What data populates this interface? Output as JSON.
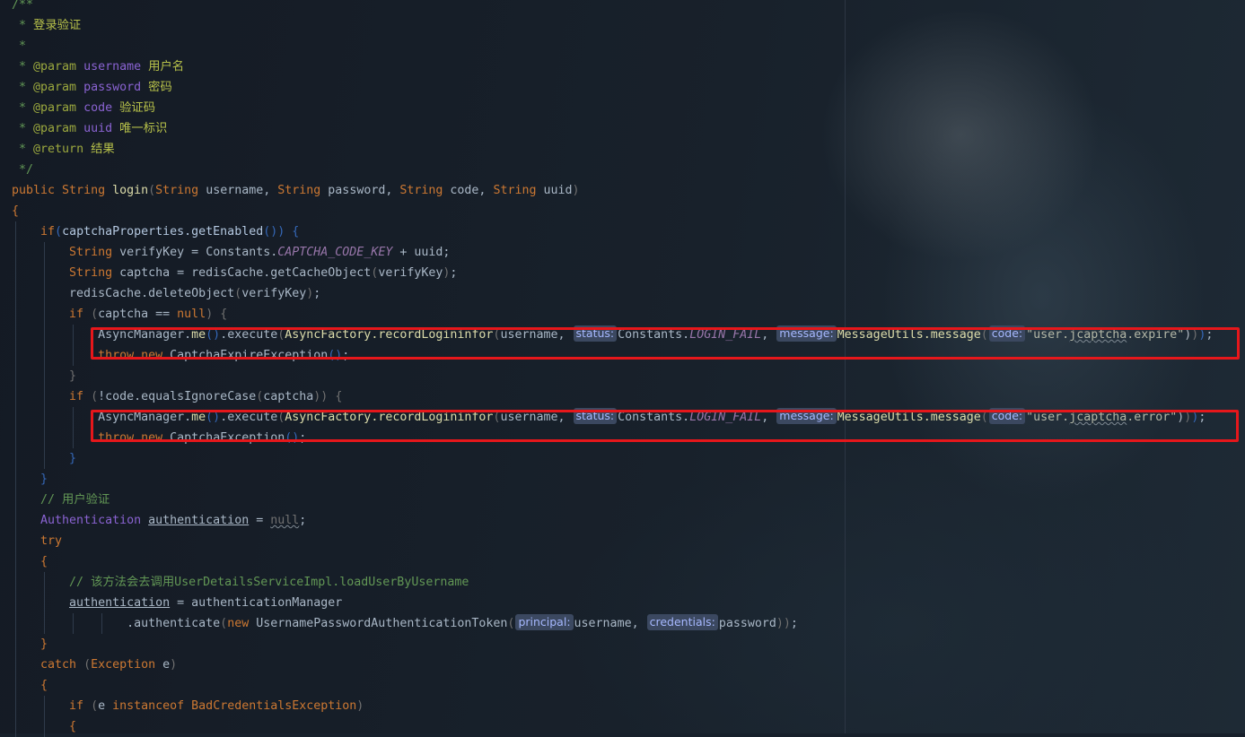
{
  "highlight_color": "#e6171b",
  "lines": [
    [
      {
        "t": "/**",
        "c": "c"
      }
    ],
    [
      {
        "t": " * ",
        "c": "c"
      },
      {
        "t": "登录验证",
        "c": "ct"
      }
    ],
    [
      {
        "t": " *",
        "c": "c"
      }
    ],
    [
      {
        "t": " * ",
        "c": "c"
      },
      {
        "t": "@param",
        "c": "cd"
      },
      {
        "t": " ",
        "c": "c"
      },
      {
        "t": "username",
        "c": "vp"
      },
      {
        "t": " 用户名",
        "c": "ct"
      }
    ],
    [
      {
        "t": " * ",
        "c": "c"
      },
      {
        "t": "@param",
        "c": "cd"
      },
      {
        "t": " ",
        "c": "c"
      },
      {
        "t": "password",
        "c": "vp"
      },
      {
        "t": " 密码",
        "c": "ct"
      }
    ],
    [
      {
        "t": " * ",
        "c": "c"
      },
      {
        "t": "@param",
        "c": "cd"
      },
      {
        "t": " ",
        "c": "c"
      },
      {
        "t": "code",
        "c": "vp"
      },
      {
        "t": " 验证码",
        "c": "ct"
      }
    ],
    [
      {
        "t": " * ",
        "c": "c"
      },
      {
        "t": "@param",
        "c": "cd"
      },
      {
        "t": " ",
        "c": "c"
      },
      {
        "t": "uuid",
        "c": "vp"
      },
      {
        "t": " 唯一标识",
        "c": "ct"
      }
    ],
    [
      {
        "t": " * ",
        "c": "c"
      },
      {
        "t": "@return",
        "c": "cd"
      },
      {
        "t": " 结果",
        "c": "ct"
      }
    ],
    [
      {
        "t": " */",
        "c": "c"
      }
    ],
    [
      {
        "t": "public ",
        "c": "kw"
      },
      {
        "t": "String ",
        "c": "ty"
      },
      {
        "t": "login",
        "c": "mt"
      },
      {
        "t": "(",
        "c": "pr"
      },
      {
        "t": "String ",
        "c": "ty"
      },
      {
        "t": "username, ",
        "c": "cl"
      },
      {
        "t": "String ",
        "c": "ty"
      },
      {
        "t": "password, ",
        "c": "cl"
      },
      {
        "t": "String ",
        "c": "ty"
      },
      {
        "t": "code, ",
        "c": "cl"
      },
      {
        "t": "String ",
        "c": "ty"
      },
      {
        "t": "uuid",
        "c": "cl"
      },
      {
        "t": ")",
        "c": "pr"
      }
    ],
    [
      {
        "t": "{",
        "c": "pn"
      }
    ],
    [
      {
        "t": "    "
      },
      {
        "t": "if",
        "c": "kw"
      },
      {
        "t": "(",
        "c": "pb"
      },
      {
        "t": "captchaProperties.getEnabled",
        "c": "fn"
      },
      {
        "t": "()",
        "c": "pb"
      },
      {
        "t": ")",
        "c": "pb"
      },
      {
        "t": " {",
        "c": "pb"
      }
    ],
    [
      {
        "t": "        "
      },
      {
        "t": "String ",
        "c": "ty"
      },
      {
        "t": "verifyKey",
        "c": "lv"
      },
      {
        "t": " = ",
        "c": "cl"
      },
      {
        "t": "Constants.",
        "c": "cl"
      },
      {
        "t": "CAPTCHA_CODE_KEY",
        "c": "cs"
      },
      {
        "t": " + uuid;",
        "c": "cl"
      }
    ],
    [
      {
        "t": "        "
      },
      {
        "t": "String ",
        "c": "ty"
      },
      {
        "t": "captcha",
        "c": "lv"
      },
      {
        "t": " = redisCache.getCacheObject",
        "c": "cl"
      },
      {
        "t": "(",
        "c": "pr"
      },
      {
        "t": "verifyKey",
        "c": "lv"
      },
      {
        "t": ")",
        "c": "pr"
      },
      {
        "t": ";",
        "c": "cl"
      }
    ],
    [
      {
        "t": "        "
      },
      {
        "t": "redisCache.deleteObject",
        "c": "cl"
      },
      {
        "t": "(",
        "c": "pr"
      },
      {
        "t": "verifyKey",
        "c": "lv"
      },
      {
        "t": ")",
        "c": "pr"
      },
      {
        "t": ";",
        "c": "cl"
      }
    ],
    [
      {
        "t": "        "
      },
      {
        "t": "if ",
        "c": "kw"
      },
      {
        "t": "(",
        "c": "pr"
      },
      {
        "t": "captcha",
        "c": "lv"
      },
      {
        "t": " == ",
        "c": "cl"
      },
      {
        "t": "null",
        "c": "kw"
      },
      {
        "t": ")",
        "c": "pr"
      },
      {
        "t": " {",
        "c": "pr"
      }
    ],
    [
      {
        "t": "            "
      },
      {
        "t": "AsyncManager.",
        "c": "cl"
      },
      {
        "t": "me",
        "c": "mt"
      },
      {
        "t": "()",
        "c": "pb"
      },
      {
        "t": ".execute",
        "c": "cl"
      },
      {
        "t": "(",
        "c": "pr"
      },
      {
        "t": "AsyncFactory.recordLogininfor",
        "c": "mt"
      },
      {
        "t": "(",
        "c": "pr"
      },
      {
        "t": "username, ",
        "c": "cl"
      },
      {
        "h": "status:"
      },
      {
        "t": "Constants.",
        "c": "cl"
      },
      {
        "t": "LOGIN_FAIL",
        "c": "cs"
      },
      {
        "t": ", ",
        "c": "cl"
      },
      {
        "h": "message:"
      },
      {
        "t": "MessageUtils.message",
        "c": "mt"
      },
      {
        "t": "(",
        "c": "pr"
      },
      {
        "h": "code:"
      },
      {
        "t": "\"user.",
        "c": "st"
      },
      {
        "t": "jcaptcha",
        "c": "st",
        "w": 1
      },
      {
        "t": ".expire\"",
        "c": "st"
      },
      {
        "t": ")",
        "c": "pw"
      },
      {
        "t": ")",
        "c": "pr"
      },
      {
        "t": ")",
        "c": "pb"
      },
      {
        "t": ";",
        "c": "cl"
      }
    ],
    [
      {
        "t": "            "
      },
      {
        "t": "throw ",
        "c": "kw"
      },
      {
        "t": "new ",
        "c": "kw"
      },
      {
        "t": "CaptchaExpireException",
        "c": "cl"
      },
      {
        "t": "()",
        "c": "pb"
      },
      {
        "t": ";",
        "c": "cl"
      }
    ],
    [
      {
        "t": "        "
      },
      {
        "t": "}",
        "c": "pr"
      }
    ],
    [
      {
        "t": "        "
      },
      {
        "t": "if ",
        "c": "kw"
      },
      {
        "t": "(",
        "c": "pr"
      },
      {
        "t": "!code.equalsIgnoreCase",
        "c": "cl"
      },
      {
        "t": "(",
        "c": "pr"
      },
      {
        "t": "captcha",
        "c": "lv"
      },
      {
        "t": ")",
        "c": "pr"
      },
      {
        "t": ")",
        "c": "pr"
      },
      {
        "t": " {",
        "c": "pr"
      }
    ],
    [
      {
        "t": "            "
      },
      {
        "t": "AsyncManager.",
        "c": "cl"
      },
      {
        "t": "me",
        "c": "mt"
      },
      {
        "t": "()",
        "c": "pb"
      },
      {
        "t": ".execute",
        "c": "cl"
      },
      {
        "t": "(",
        "c": "pr"
      },
      {
        "t": "AsyncFactory.recordLogininfor",
        "c": "mt"
      },
      {
        "t": "(",
        "c": "pr"
      },
      {
        "t": "username, ",
        "c": "cl"
      },
      {
        "h": "status:"
      },
      {
        "t": "Constants.",
        "c": "cl"
      },
      {
        "t": "LOGIN_FAIL",
        "c": "cs"
      },
      {
        "t": ", ",
        "c": "cl"
      },
      {
        "h": "message:"
      },
      {
        "t": "MessageUtils.message",
        "c": "mt"
      },
      {
        "t": "(",
        "c": "pr"
      },
      {
        "h": "code:"
      },
      {
        "t": "\"user.",
        "c": "st"
      },
      {
        "t": "jcaptcha",
        "c": "st",
        "w": 1
      },
      {
        "t": ".error\"",
        "c": "st"
      },
      {
        "t": ")",
        "c": "pw"
      },
      {
        "t": ")",
        "c": "pr"
      },
      {
        "t": ")",
        "c": "pb"
      },
      {
        "t": ";",
        "c": "cl"
      }
    ],
    [
      {
        "t": "            "
      },
      {
        "t": "throw ",
        "c": "kw"
      },
      {
        "t": "new ",
        "c": "kw"
      },
      {
        "t": "CaptchaException",
        "c": "cl"
      },
      {
        "t": "()",
        "c": "pb"
      },
      {
        "t": ";",
        "c": "cl"
      }
    ],
    [
      {
        "t": "        "
      },
      {
        "t": "}",
        "c": "pb"
      }
    ],
    [
      {
        "t": "    "
      },
      {
        "t": "}",
        "c": "pb"
      }
    ],
    [
      {
        "t": "    "
      },
      {
        "t": "// 用户验证",
        "c": "c"
      }
    ],
    [
      {
        "t": "    "
      },
      {
        "t": "Authentication ",
        "c": "vp"
      },
      {
        "t": "authentication",
        "c": "cl",
        "u": 1
      },
      {
        "t": " = ",
        "c": "cl"
      },
      {
        "t": "null",
        "c": "pr",
        "w": 1
      },
      {
        "t": ";",
        "c": "cl"
      }
    ],
    [
      {
        "t": "    "
      },
      {
        "t": "try",
        "c": "kw"
      }
    ],
    [
      {
        "t": "    "
      },
      {
        "t": "{",
        "c": "pn"
      }
    ],
    [
      {
        "t": "        "
      },
      {
        "t": "// 该方法会去调用UserDetailsServiceImpl.loadUserByUsername",
        "c": "c"
      }
    ],
    [
      {
        "t": "        "
      },
      {
        "t": "authentication",
        "c": "cl",
        "u": 1
      },
      {
        "t": " = authenticationManager",
        "c": "cl"
      }
    ],
    [
      {
        "t": "                "
      },
      {
        "t": ".authenticate",
        "c": "cl"
      },
      {
        "t": "(",
        "c": "pr"
      },
      {
        "t": "new ",
        "c": "kw"
      },
      {
        "t": "UsernamePasswordAuthenticationToken",
        "c": "cl"
      },
      {
        "t": "(",
        "c": "pr"
      },
      {
        "h": "principal:"
      },
      {
        "t": "username, ",
        "c": "cl"
      },
      {
        "h": "credentials:"
      },
      {
        "t": "password",
        "c": "cl"
      },
      {
        "t": ")",
        "c": "pr"
      },
      {
        "t": ")",
        "c": "pr"
      },
      {
        "t": ";",
        "c": "cl"
      }
    ],
    [
      {
        "t": "    "
      },
      {
        "t": "}",
        "c": "pn"
      }
    ],
    [
      {
        "t": "    "
      },
      {
        "t": "catch ",
        "c": "kw"
      },
      {
        "t": "(",
        "c": "pr"
      },
      {
        "t": "Exception ",
        "c": "ty"
      },
      {
        "t": "e",
        "c": "cl"
      },
      {
        "t": ")",
        "c": "pr"
      }
    ],
    [
      {
        "t": "    "
      },
      {
        "t": "{",
        "c": "pn"
      }
    ],
    [
      {
        "t": "        "
      },
      {
        "t": "if ",
        "c": "kw"
      },
      {
        "t": "(",
        "c": "pr"
      },
      {
        "t": "e ",
        "c": "cl"
      },
      {
        "t": "instanceof ",
        "c": "kw"
      },
      {
        "t": "BadCredentialsException",
        "c": "ty"
      },
      {
        "t": ")",
        "c": "pr"
      }
    ],
    [
      {
        "t": "        "
      },
      {
        "t": "{",
        "c": "pn"
      }
    ]
  ]
}
